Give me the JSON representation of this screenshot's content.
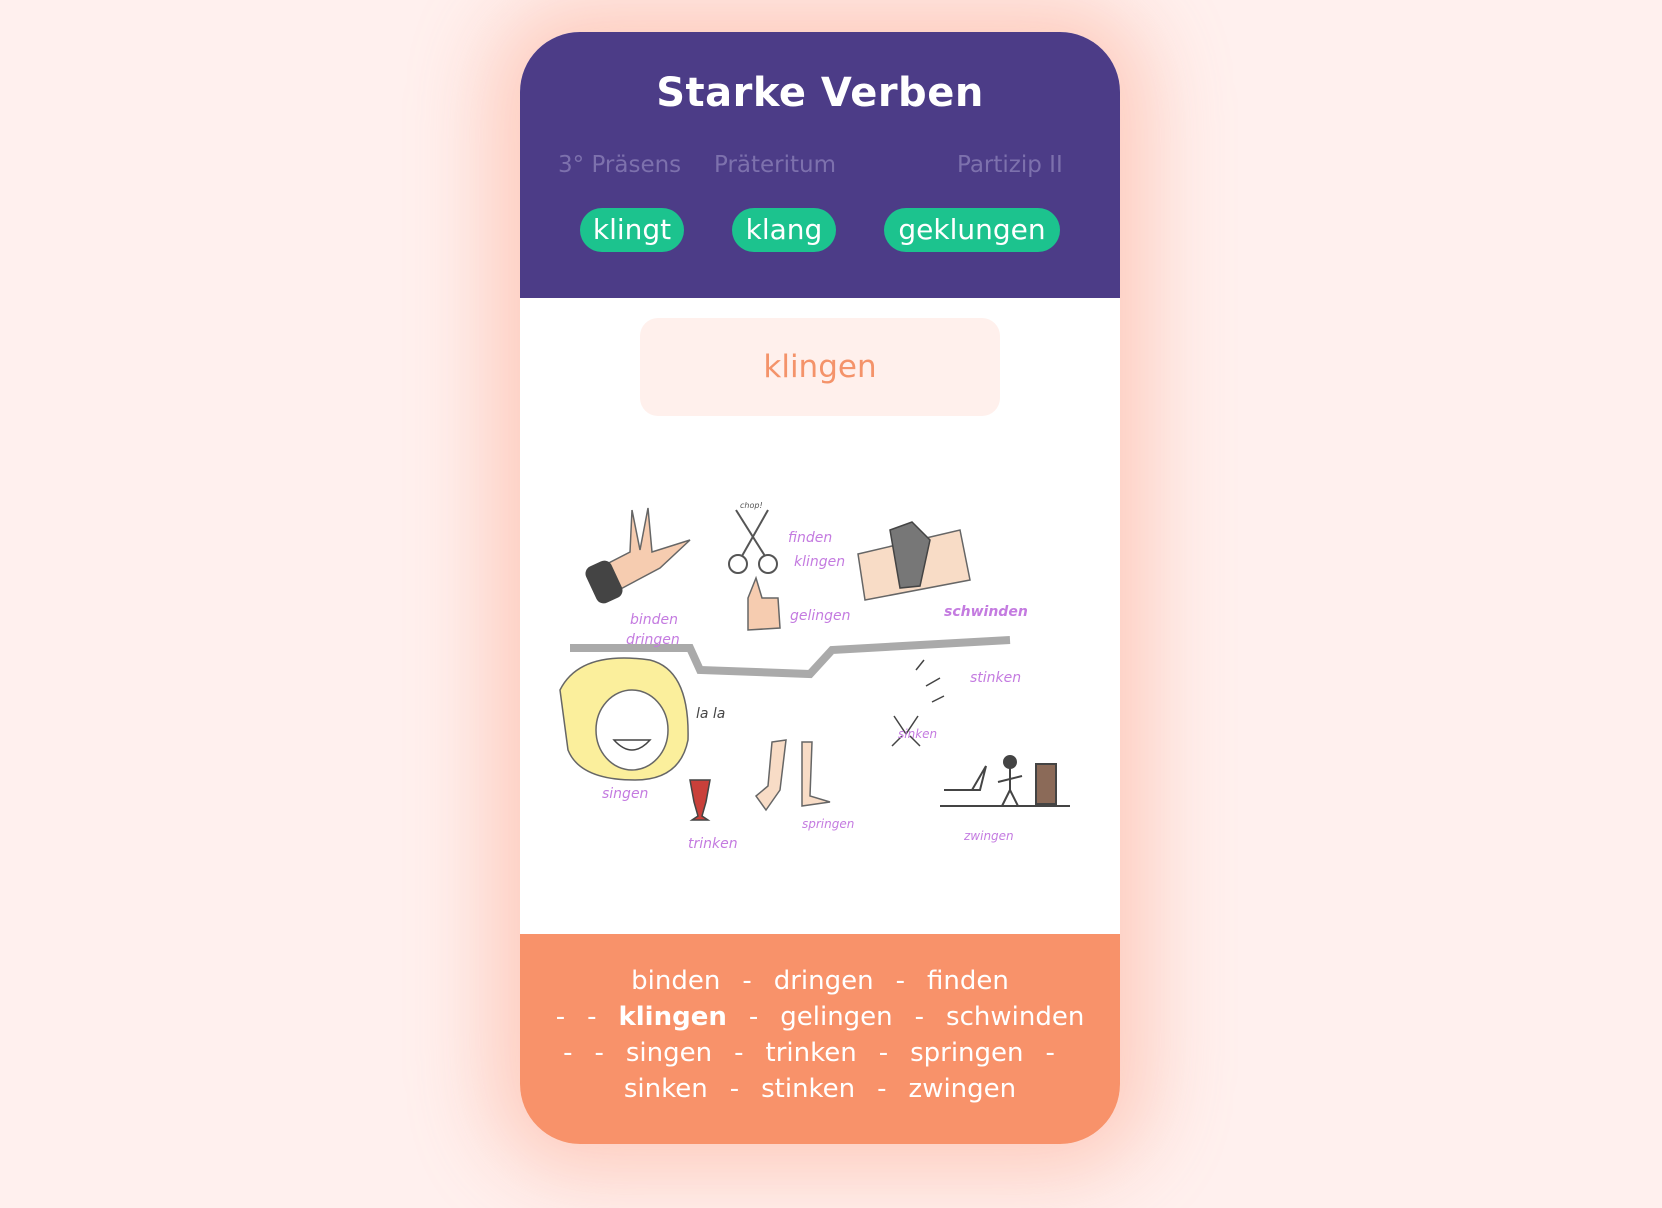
{
  "header": {
    "title": "Starke Verben",
    "columns": [
      "3° Präsens",
      "Präteritum",
      "Partizip II"
    ],
    "forms": [
      "klingt",
      "klang",
      "geklungen"
    ]
  },
  "infinitive": "klingen",
  "illustration": {
    "labels": {
      "chop": "chop!",
      "binden": "binden",
      "dringen": "dringen",
      "finden": "finden",
      "klingen": "klingen",
      "gelingen": "gelingen",
      "schwinden": "schwinden",
      "stinken": "stinken",
      "sinken": "sinken",
      "lala": "la la",
      "singen": "singen",
      "trinken": "trinken",
      "springen": "springen",
      "zwingen": "zwingen"
    }
  },
  "footer": {
    "rows": [
      [
        "binden",
        "dringen",
        "finden"
      ],
      [
        "",
        "klingen",
        "gelingen",
        "schwinden"
      ],
      [
        "",
        "singen",
        "trinken",
        "springen",
        ""
      ],
      [
        "sinken",
        "stinken",
        "zwingen"
      ]
    ],
    "separator": "-",
    "active": "klingen"
  },
  "colors": {
    "header_bg": "#4c3c87",
    "pill_bg": "#1cc38e",
    "footer_bg": "#f8926a",
    "accent": "#f4936a",
    "sketch_label": "#c47be0"
  }
}
